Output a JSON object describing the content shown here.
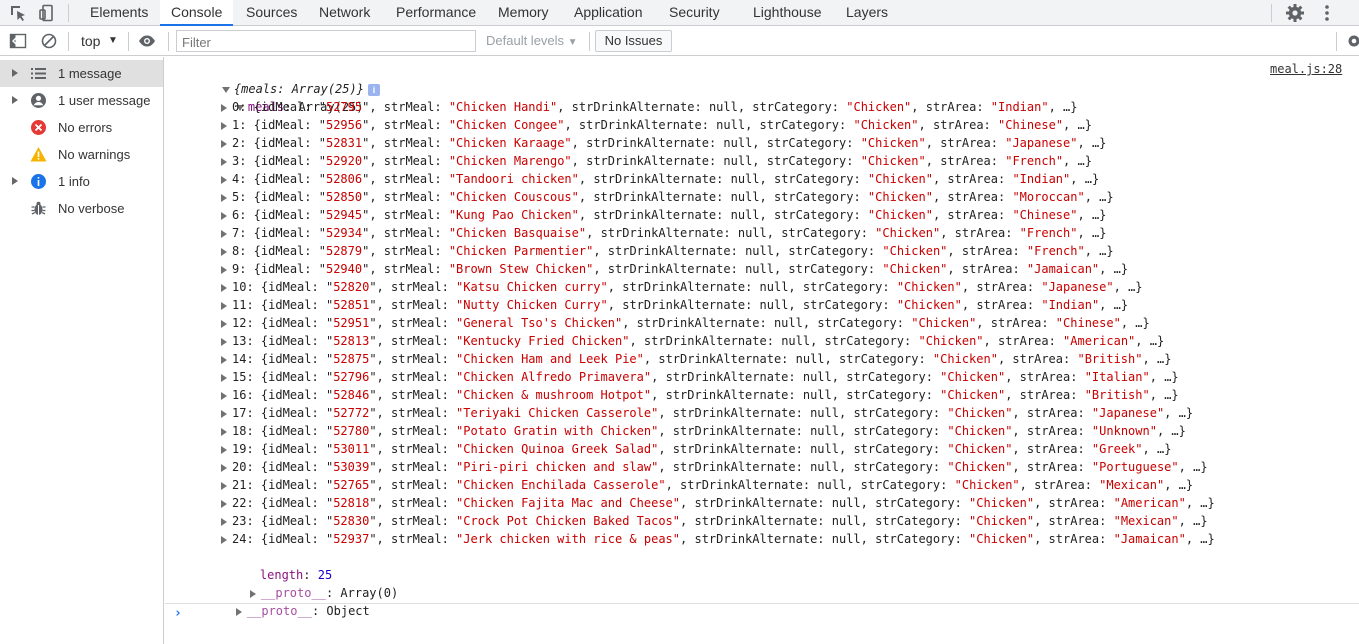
{
  "tabs": [
    {
      "label": "Elements"
    },
    {
      "label": "Console"
    },
    {
      "label": "Sources"
    },
    {
      "label": "Network"
    },
    {
      "label": "Performance"
    },
    {
      "label": "Memory"
    },
    {
      "label": "Application"
    },
    {
      "label": "Security"
    },
    {
      "label": "Lighthouse"
    },
    {
      "label": "Layers"
    }
  ],
  "active_tab": "Console",
  "toolbar": {
    "context": "top",
    "filter_placeholder": "Filter",
    "levels": "Default levels",
    "issues": "No Issues"
  },
  "sidebar": {
    "items": [
      {
        "label": "1 message",
        "icon": "list-icon"
      },
      {
        "label": "1 user message",
        "icon": "user-icon"
      },
      {
        "label": "No errors",
        "icon": "error-icon"
      },
      {
        "label": "No warnings",
        "icon": "warning-icon"
      },
      {
        "label": "1 info",
        "icon": "info-icon"
      },
      {
        "label": "No verbose",
        "icon": "bug-icon"
      }
    ]
  },
  "console": {
    "source": "meal.js:28",
    "root_summary": "{meals: Array(25)}",
    "meals_label": "meals",
    "meals_type": "Array(25)",
    "rows": [
      {
        "i": "0",
        "id": "52795",
        "meal": "Chicken Handi",
        "area": "Indian"
      },
      {
        "i": "1",
        "id": "52956",
        "meal": "Chicken Congee",
        "area": "Chinese"
      },
      {
        "i": "2",
        "id": "52831",
        "meal": "Chicken Karaage",
        "area": "Japanese"
      },
      {
        "i": "3",
        "id": "52920",
        "meal": "Chicken Marengo",
        "area": "French"
      },
      {
        "i": "4",
        "id": "52806",
        "meal": "Tandoori chicken",
        "area": "Indian"
      },
      {
        "i": "5",
        "id": "52850",
        "meal": "Chicken Couscous",
        "area": "Moroccan"
      },
      {
        "i": "6",
        "id": "52945",
        "meal": "Kung Pao Chicken",
        "area": "Chinese"
      },
      {
        "i": "7",
        "id": "52934",
        "meal": "Chicken Basquaise",
        "area": "French"
      },
      {
        "i": "8",
        "id": "52879",
        "meal": "Chicken Parmentier",
        "area": "French"
      },
      {
        "i": "9",
        "id": "52940",
        "meal": "Brown Stew Chicken",
        "area": "Jamaican"
      },
      {
        "i": "10",
        "id": "52820",
        "meal": "Katsu Chicken curry",
        "area": "Japanese"
      },
      {
        "i": "11",
        "id": "52851",
        "meal": "Nutty Chicken Curry",
        "area": "Indian"
      },
      {
        "i": "12",
        "id": "52951",
        "meal": "General Tso's Chicken",
        "area": "Chinese"
      },
      {
        "i": "13",
        "id": "52813",
        "meal": "Kentucky Fried Chicken",
        "area": "American"
      },
      {
        "i": "14",
        "id": "52875",
        "meal": "Chicken Ham and Leek Pie",
        "area": "British"
      },
      {
        "i": "15",
        "id": "52796",
        "meal": "Chicken Alfredo Primavera",
        "area": "Italian"
      },
      {
        "i": "16",
        "id": "52846",
        "meal": "Chicken & mushroom Hotpot",
        "area": "British"
      },
      {
        "i": "17",
        "id": "52772",
        "meal": "Teriyaki Chicken Casserole",
        "area": "Japanese"
      },
      {
        "i": "18",
        "id": "52780",
        "meal": "Potato Gratin with Chicken",
        "area": "Unknown"
      },
      {
        "i": "19",
        "id": "53011",
        "meal": "Chicken Quinoa Greek Salad",
        "area": "Greek"
      },
      {
        "i": "20",
        "id": "53039",
        "meal": "Piri-piri chicken and slaw",
        "area": "Portuguese"
      },
      {
        "i": "21",
        "id": "52765",
        "meal": "Chicken Enchilada Casserole",
        "area": "Mexican"
      },
      {
        "i": "22",
        "id": "52818",
        "meal": "Chicken Fajita Mac and Cheese",
        "area": "American"
      },
      {
        "i": "23",
        "id": "52830",
        "meal": "Crock Pot Chicken Baked Tacos",
        "area": "Mexican"
      },
      {
        "i": "24",
        "id": "52937",
        "meal": "Jerk chicken with rice & peas",
        "area": "Jamaican"
      }
    ],
    "row_keys": {
      "idMeal": "idMeal",
      "strMeal": "strMeal",
      "strDrinkAlternate": "strDrinkAlternate",
      "strCategory": "strCategory",
      "strArea": "strArea"
    },
    "null_text": "null",
    "category_value": "Chicken",
    "ellipsis": "…",
    "length_label": "length",
    "length_value": "25",
    "proto_label": "__proto__",
    "array_proto": "Array(0)",
    "object_proto": "Object",
    "prompt": "›"
  }
}
